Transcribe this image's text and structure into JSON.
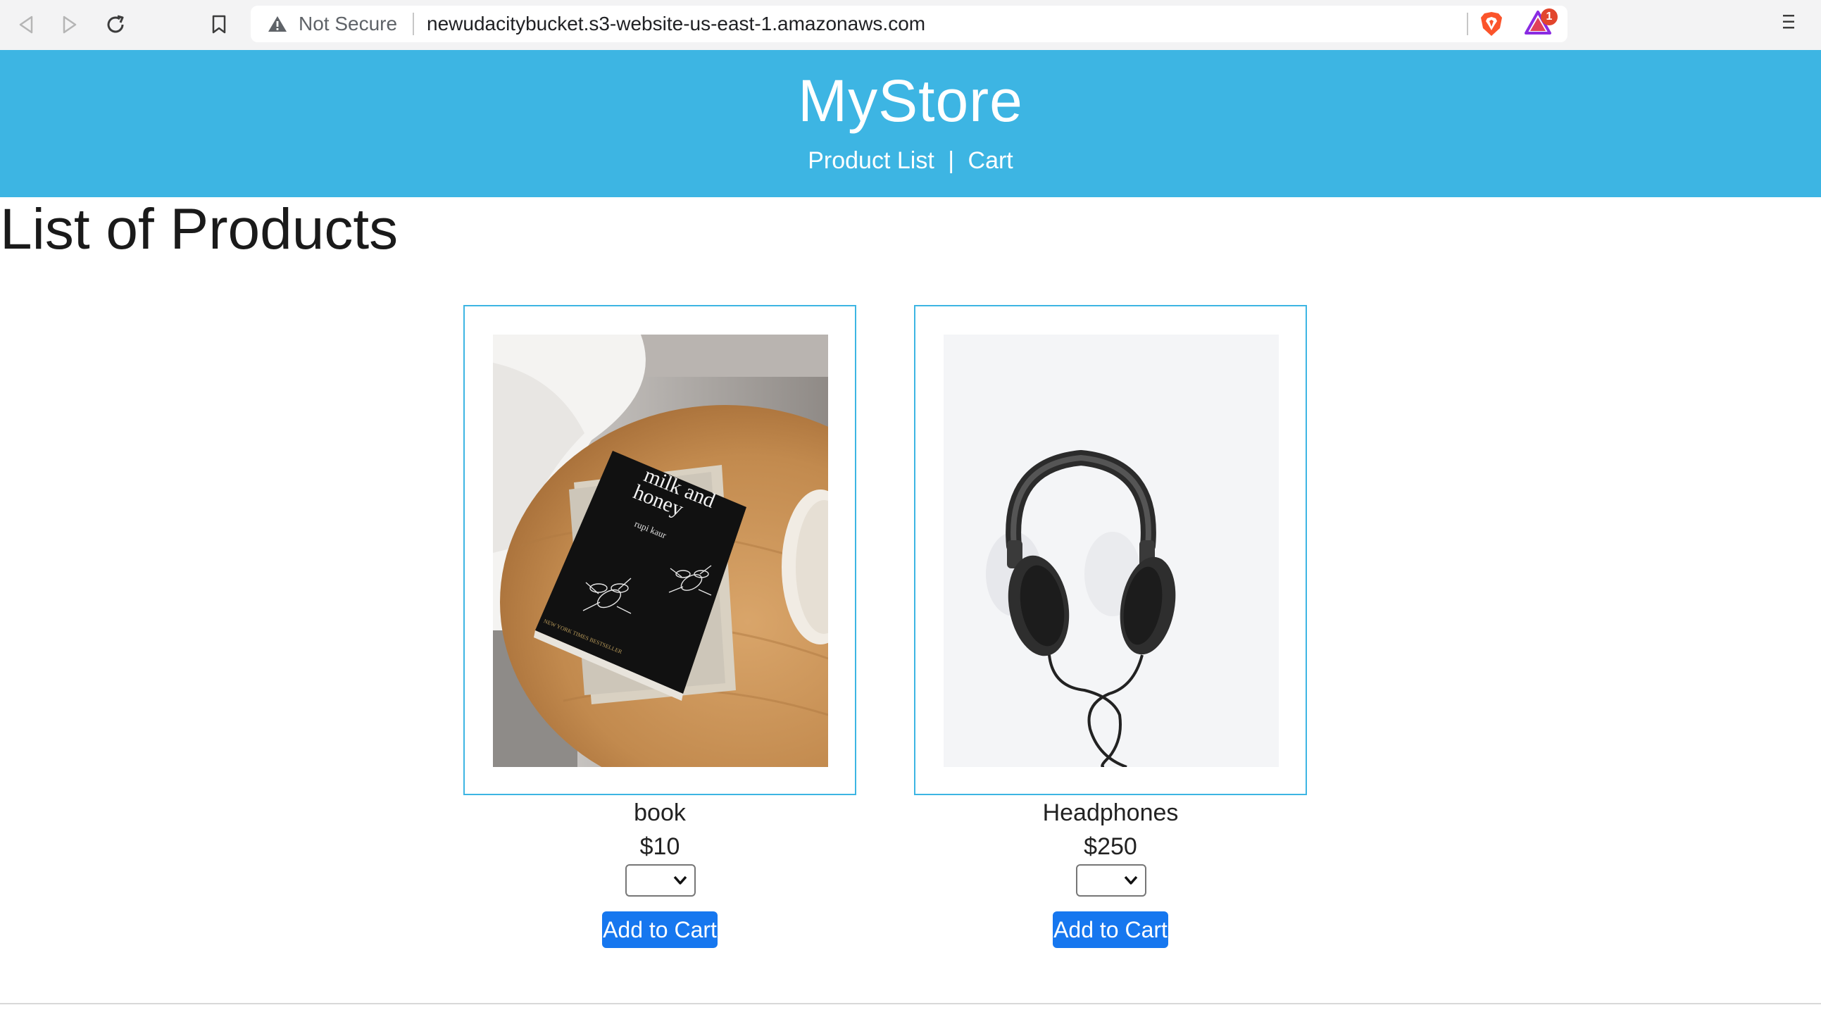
{
  "browser": {
    "url_warning": "Not Secure",
    "url": "newudacitybucket.s3-website-us-east-1.amazonaws.com",
    "rewards_badge": "1"
  },
  "header": {
    "title": "MyStore",
    "nav": {
      "product_list": "Product List",
      "separator": "|",
      "cart": "Cart"
    },
    "background_color": "#3db5e3"
  },
  "main": {
    "heading": "List of Products",
    "products": [
      {
        "name": "book",
        "price": "$10",
        "quantity": "",
        "add_label": "Add to Cart",
        "image": "book-photo"
      },
      {
        "name": "Headphones",
        "price": "$250",
        "quantity": "",
        "add_label": "Add to Cart",
        "image": "headphones-photo"
      }
    ],
    "book_cover": {
      "title_line1": "milk and",
      "title_line2": "honey",
      "author": "rupi kaur",
      "tagline": "NEW YORK TIMES BESTSELLER"
    }
  },
  "colors": {
    "accent": "#3db5e3",
    "button": "#1677ef"
  }
}
